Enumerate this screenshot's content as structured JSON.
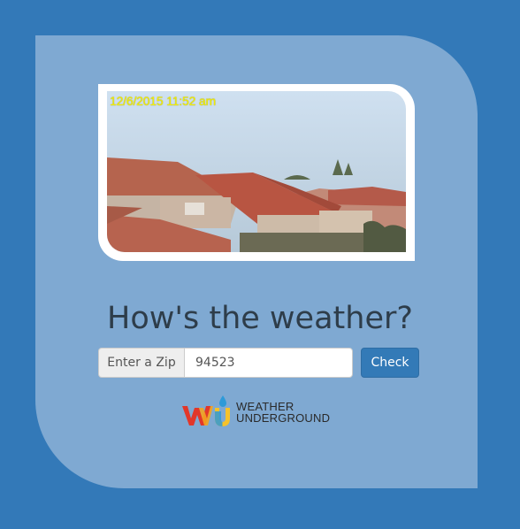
{
  "webcam": {
    "timestamp": "12/6/2015 11:52 am"
  },
  "heading": "How's the weather?",
  "zip_form": {
    "label": "Enter a Zip",
    "value": "94523",
    "button_label": "Check"
  },
  "logo": {
    "line1": "WEATHER",
    "line2": "UNDERGROUND"
  },
  "colors": {
    "page_bg": "#3379b8",
    "card_bg": "#7fa9d2",
    "button_bg": "#337ab7",
    "heading_text": "#2e3d4a",
    "timestamp": "#f4f000"
  }
}
